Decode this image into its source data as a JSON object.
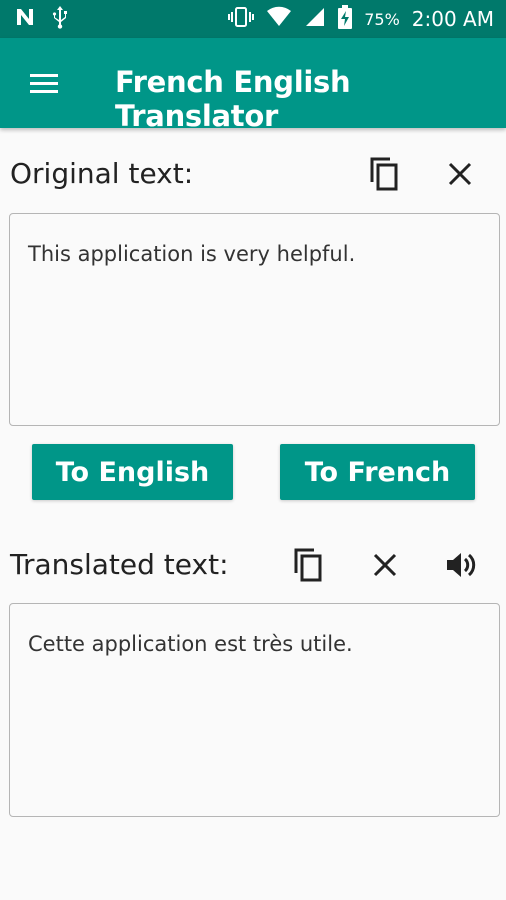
{
  "status_bar": {
    "battery": "75%",
    "time": "2:00 AM",
    "icons": [
      "n-icon",
      "usb-icon",
      "vibrate-icon",
      "wifi-icon",
      "signal-icon",
      "battery-charging-icon"
    ]
  },
  "app_bar": {
    "title": "French English Translator",
    "menu_icon": "hamburger-menu-icon"
  },
  "original": {
    "label": "Original text:",
    "value": "This application is very helpful.",
    "copy_icon": "copy-icon",
    "clear_icon": "close-icon"
  },
  "buttons": {
    "to_english": "To English",
    "to_french": "To French"
  },
  "translated": {
    "label": "Translated text:",
    "value": "Cette application est très utile.",
    "copy_icon": "copy-icon",
    "clear_icon": "close-icon",
    "speak_icon": "speaker-icon"
  },
  "colors": {
    "status_bar": "#00796b",
    "primary": "#009688",
    "background": "#fafafa",
    "text": "#222222"
  }
}
